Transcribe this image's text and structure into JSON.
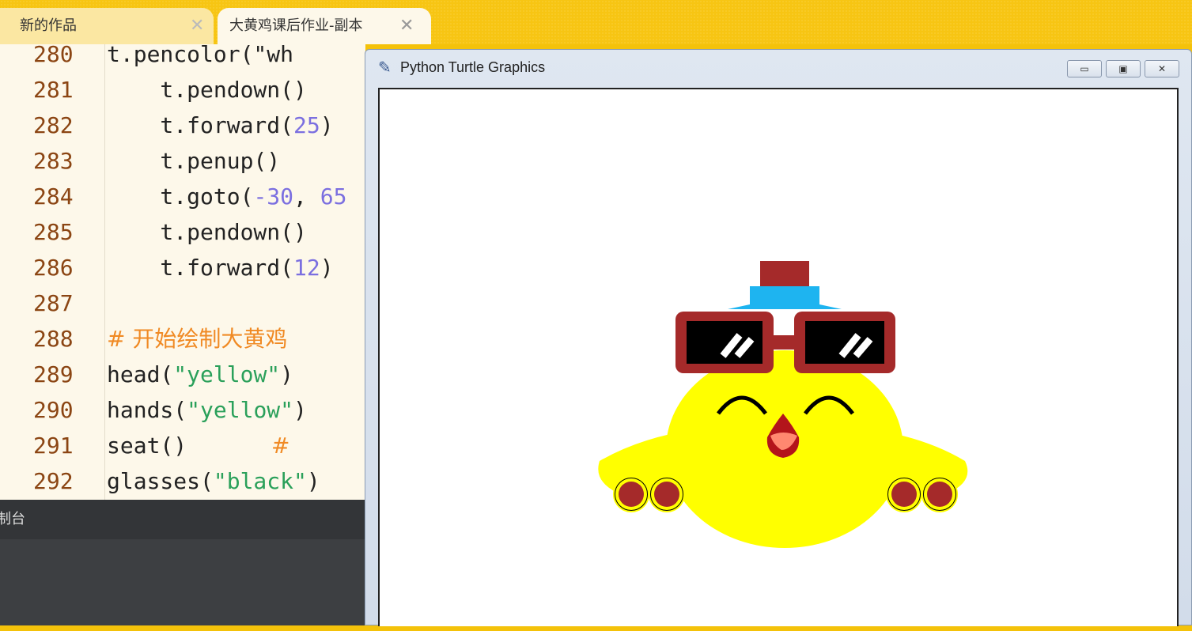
{
  "tabs": [
    {
      "label": "新的作品",
      "close": "✕"
    },
    {
      "label": "大黄鸡课后作业-副本",
      "close": "✕"
    }
  ],
  "editor": {
    "lines": [
      {
        "n": "280",
        "parts": [
          [
            "t.pencolor(\"wh",
            "plain"
          ]
        ]
      },
      {
        "n": "281",
        "parts": [
          [
            "    t.pendown()",
            "plain"
          ]
        ]
      },
      {
        "n": "282",
        "parts": [
          [
            "    t.forward(",
            "plain"
          ],
          [
            "25",
            "num"
          ],
          [
            ")",
            "plain"
          ]
        ]
      },
      {
        "n": "283",
        "parts": [
          [
            "    t.penup()",
            "plain"
          ]
        ]
      },
      {
        "n": "284",
        "parts": [
          [
            "    t.goto(",
            "plain"
          ],
          [
            "-30",
            "num"
          ],
          [
            ", ",
            "plain"
          ],
          [
            "65",
            "num"
          ]
        ]
      },
      {
        "n": "285",
        "parts": [
          [
            "    t.pendown()",
            "plain"
          ]
        ]
      },
      {
        "n": "286",
        "parts": [
          [
            "    t.forward(",
            "plain"
          ],
          [
            "12",
            "num"
          ],
          [
            ")",
            "plain"
          ]
        ]
      },
      {
        "n": "287",
        "parts": []
      },
      {
        "n": "288",
        "parts": [
          [
            "# 开始绘制大黄鸡",
            "cmt"
          ]
        ]
      },
      {
        "n": "289",
        "parts": [
          [
            "head(",
            "plain"
          ],
          [
            "\"yellow\"",
            "str"
          ],
          [
            ")",
            "plain"
          ]
        ]
      },
      {
        "n": "290",
        "parts": [
          [
            "hands(",
            "plain"
          ],
          [
            "\"yellow\"",
            "str"
          ],
          [
            ")",
            "plain"
          ]
        ]
      },
      {
        "n": "291",
        "parts": [
          [
            "seat()",
            "plain"
          ],
          [
            "            #",
            "cmt"
          ]
        ]
      },
      {
        "n": "292",
        "parts": [
          [
            "glasses(",
            "plain"
          ],
          [
            "\"black\"",
            "str"
          ],
          [
            ")",
            "plain"
          ]
        ]
      }
    ]
  },
  "console": {
    "title": "制台"
  },
  "turtle_window": {
    "title": "Python Turtle Graphics",
    "buttons": {
      "minimize": "▭",
      "maximize": "▣",
      "close": "✕"
    }
  },
  "colors": {
    "chick_body": "#ffff00",
    "glasses_frame": "#a52a2a",
    "hat_top": "#a52a2a",
    "hat_band": "#1eb4f0",
    "beak": "#b3151b",
    "tongue": "#ff8870"
  }
}
